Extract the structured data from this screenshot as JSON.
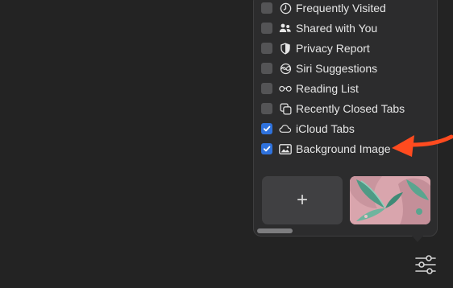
{
  "customize_menu": {
    "items": [
      {
        "label": "Frequently Visited",
        "icon": "clock-icon",
        "checked": false
      },
      {
        "label": "Shared with You",
        "icon": "people-icon",
        "checked": false
      },
      {
        "label": "Privacy Report",
        "icon": "shield-icon",
        "checked": false
      },
      {
        "label": "Siri Suggestions",
        "icon": "siri-icon",
        "checked": false
      },
      {
        "label": "Reading List",
        "icon": "glasses-icon",
        "checked": false
      },
      {
        "label": "Recently Closed Tabs",
        "icon": "tabs-icon",
        "checked": false
      },
      {
        "label": "iCloud Tabs",
        "icon": "cloud-icon",
        "checked": true
      },
      {
        "label": "Background Image",
        "icon": "photo-icon",
        "checked": true
      }
    ],
    "add_tile_label": "+",
    "accent_color": "#2f72dd",
    "arrow_color": "#ff4b1f"
  }
}
